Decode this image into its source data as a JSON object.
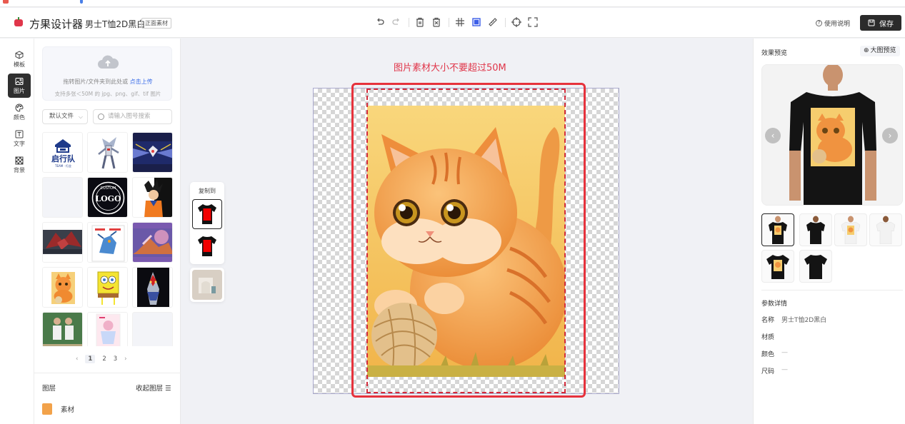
{
  "app": {
    "title": "方果设计器",
    "design_name": "男士T恤2D黑白",
    "side_badge": "正面素材"
  },
  "header": {
    "help_label": "使用说明",
    "save_label": "保存"
  },
  "rail": {
    "items": [
      {
        "label": "模板",
        "icon": "cube-icon"
      },
      {
        "label": "图片",
        "icon": "image-icon"
      },
      {
        "label": "颜色",
        "icon": "palette-icon"
      },
      {
        "label": "文字",
        "icon": "text-icon"
      },
      {
        "label": "背景",
        "icon": "checker-icon"
      }
    ]
  },
  "upload": {
    "hint_prefix": "拖转图片/文件夹到此处或",
    "hint_link": "点击上传",
    "sub": "支持多张＜50M 的 jpg、png、gif、tif 图片"
  },
  "filters": {
    "folder": "默认文件",
    "search_placeholder": "请输入图号搜索"
  },
  "thumbs": {
    "logo_text": "启行队",
    "logo_sub": "TEAM · 行业",
    "custom_logo_text": "LOGO",
    "custom_top": "CUSTOM"
  },
  "pager": {
    "pages": [
      "1",
      "2",
      "3"
    ],
    "current": "1",
    "prev": "‹",
    "next": "›"
  },
  "layers": {
    "title": "图层",
    "collapse_label": "收起图层",
    "items": [
      {
        "name": "素材"
      }
    ]
  },
  "canvas": {
    "warning": "图片素材大小不要超过50M"
  },
  "copy_panel": {
    "label": "复制到"
  },
  "preview": {
    "title": "效果预览",
    "big_label": "大图预览",
    "prev": "‹",
    "next": "›"
  },
  "params": {
    "title": "参数详情",
    "rows": [
      {
        "key": "名称",
        "value": "男士T恤2D黑白"
      },
      {
        "key": "材质",
        "value": ""
      },
      {
        "key": "颜色",
        "value": "—"
      },
      {
        "key": "尺码",
        "value": "—"
      }
    ]
  },
  "colors": {
    "accent_red": "#e6323c",
    "save_bg": "#2b2b2b",
    "active_tool": "#3c5ee8",
    "link_blue": "#3c6ee8"
  }
}
